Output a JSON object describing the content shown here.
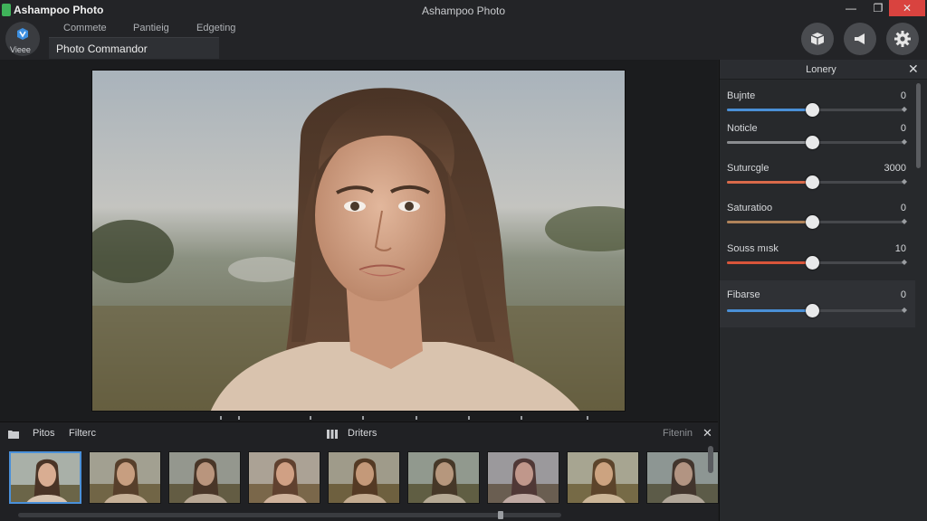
{
  "app": {
    "name": "Ashampoo Photo",
    "window_title": "Ashampoo Photo"
  },
  "window_controls": {
    "minimize": "—",
    "maximize": "❐",
    "close": "✕"
  },
  "menu": {
    "view_label": "Vieee",
    "items": [
      "Commete",
      "Pantieig",
      "Edgeting"
    ],
    "commander": "Photo Commandor"
  },
  "toolbar_icons": [
    "box-icon",
    "megaphone-icon",
    "gear-icon"
  ],
  "panel": {
    "title": "Lonery",
    "close": "✕",
    "adjustments": [
      {
        "label": "Bujnte",
        "value": "0",
        "level": 0.48,
        "fill": "#4a8fd6"
      },
      {
        "label": "Noticle",
        "value": "0",
        "level": 0.48,
        "fill": "#8a8c90"
      },
      {
        "label": "Suturcgle",
        "value": "3000",
        "level": 0.48,
        "fill": "#d96a4a"
      },
      {
        "label": "Saturatioo",
        "value": "0",
        "level": 0.48,
        "fill": "#b0835a"
      },
      {
        "label": "Souss mısk",
        "value": "10",
        "level": 0.48,
        "fill": "#d9553a"
      },
      {
        "label": "Fibarse",
        "value": "0",
        "level": 0.48,
        "fill": "#4a8fd6"
      }
    ]
  },
  "strip": {
    "tab1": "Pitos",
    "tab2": "Filterc",
    "center": "Driters",
    "right": "Fitenin",
    "close": "✕",
    "thumb_count": 9,
    "active_index": 0
  },
  "colors": {
    "accent": "#4a90d9",
    "close_red": "#d9433f",
    "logo_green": "#3fb35a"
  }
}
